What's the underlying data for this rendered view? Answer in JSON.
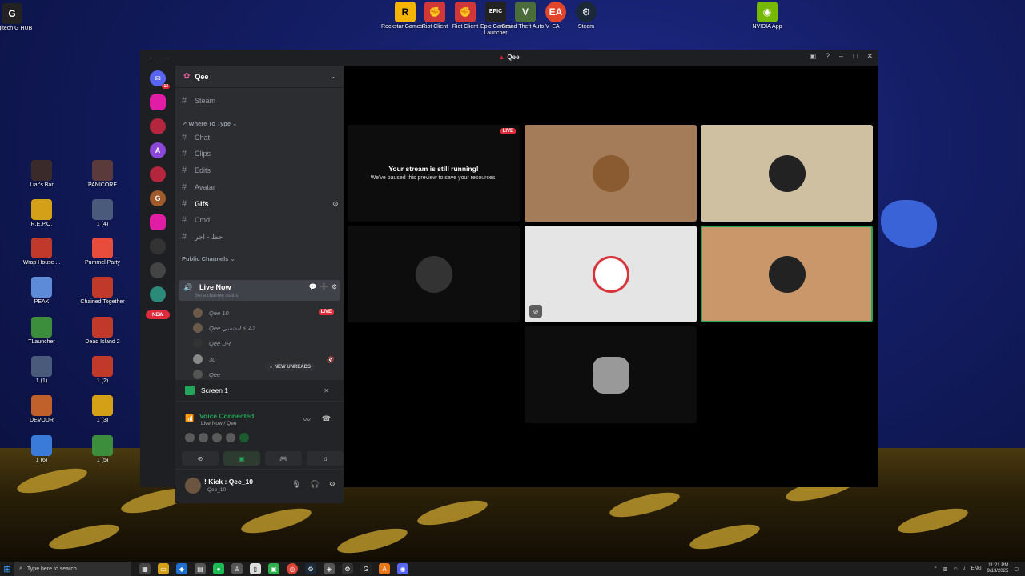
{
  "desktop": {
    "top_icons": [
      {
        "label": "Logitech G HUB",
        "icon": "logitech-icon",
        "color": "#222222"
      },
      {
        "label": "Rockstar Games ...",
        "icon": "rockstar-icon",
        "color": "#f5b400"
      },
      {
        "label": "Riot Client",
        "icon": "riot-icon",
        "color": "#d13639"
      },
      {
        "label": "Riot Client",
        "icon": "riot-icon",
        "color": "#d13639"
      },
      {
        "label": "Epic Games Launcher",
        "icon": "epic-icon",
        "color": "#222222"
      },
      {
        "label": "Grand Theft Auto V",
        "icon": "gta-icon",
        "color": "#4a6b3a"
      },
      {
        "label": "EA",
        "icon": "ea-icon",
        "color": "#e2452a"
      },
      {
        "label": "Steam",
        "icon": "steam-icon",
        "color": "#1b2838"
      },
      {
        "label": "NVIDIA App",
        "icon": "nvidia-icon",
        "color": "#76b900"
      }
    ],
    "left_icons": [
      {
        "label": "Liar's Bar",
        "color": "#3a2a2a"
      },
      {
        "label": "PANICORE",
        "color": "#5a3a3a"
      },
      {
        "label": "R.E.P.O.",
        "color": "#d4a017"
      },
      {
        "label": "1 (4)",
        "color": "#4a5a7a"
      },
      {
        "label": "Wrap House ...",
        "color": "#c0392b"
      },
      {
        "label": "Pummel Party",
        "color": "#e74c3c"
      },
      {
        "label": "PEAK",
        "color": "#5d8bd8"
      },
      {
        "label": "Chained Together",
        "color": "#c0392b"
      },
      {
        "label": "TLauncher",
        "color": "#3c8d3c"
      },
      {
        "label": "Dead Island 2",
        "color": "#c0392b"
      },
      {
        "label": "1 (1)",
        "color": "#4a5a7a"
      },
      {
        "label": "1 (2)",
        "color": "#c0392b"
      },
      {
        "label": "DEVOUR",
        "color": "#c0612b"
      },
      {
        "label": "1 (3)",
        "color": "#d4a017"
      },
      {
        "label": "1 (6)",
        "color": "#3a7ad8"
      },
      {
        "label": "1 (5)",
        "color": "#3c8d3c"
      }
    ]
  },
  "window": {
    "title": "Qee",
    "nav_back": "←",
    "nav_forward": "→"
  },
  "servers": [
    {
      "color": "#5865f2",
      "badge": "13",
      "icon": "discord-home-icon",
      "text": "🎮"
    },
    {
      "color": "#e11da6",
      "badge": "",
      "icon": "server-icon",
      "text": ""
    },
    {
      "color": "#b3263e",
      "badge": "",
      "icon": "server-icon",
      "text": ""
    },
    {
      "color": "#8a47d8",
      "badge": "",
      "icon": "server-icon",
      "text": "A"
    },
    {
      "color": "#b3263e",
      "badge": "",
      "icon": "server-icon",
      "text": ""
    },
    {
      "color": "#a05a2c",
      "badge": "",
      "icon": "server-icon",
      "text": "G"
    },
    {
      "color": "#e11da6",
      "badge": "",
      "icon": "server-icon",
      "text": ""
    },
    {
      "color": "#333333",
      "badge": "",
      "icon": "server-icon",
      "text": ""
    },
    {
      "color": "#444444",
      "badge": "",
      "icon": "server-icon",
      "text": ""
    },
    {
      "color": "#2b8a7a",
      "badge": "",
      "icon": "server-icon",
      "text": ""
    }
  ],
  "new_pill": "NEW",
  "guild": {
    "name": "Qee"
  },
  "channels": {
    "steam": "Steam",
    "category_where": "Where To Type",
    "chat": "Chat",
    "clips": "Clips",
    "edits": "Edits",
    "avatar": "Avatar",
    "gifs": "Gifs",
    "cmd": "Cmd",
    "arabic": "حظ - اجر",
    "category_public": "Public Channels",
    "live_now": "Live Now",
    "live_now_status": "Set a channel status",
    "voice_users": [
      {
        "name": "Qee 10",
        "live": true
      },
      {
        "name": "Qee الدنسي ⚡ A2",
        "live": false
      },
      {
        "name": "Qee DR",
        "live": false
      },
      {
        "name": "30",
        "live": false
      },
      {
        "name": "Qee",
        "live": false
      }
    ],
    "live_label": "LIVE",
    "new_unreads": "NEW UNREADS"
  },
  "screen_card": {
    "title": "Screen 1"
  },
  "voice": {
    "connected": "Voice Connected",
    "channel": "Live Now / Qee"
  },
  "user": {
    "name": "! Kick : Qee_10",
    "status": "Qee_10"
  },
  "stage": {
    "paused_title": "Your stream is still running!",
    "paused_sub": "We've paused this preview to save your resources.",
    "live_label": "LIVE"
  },
  "taskbar": {
    "search_placeholder": "Type here to search",
    "lang": "ENG",
    "time": "11:21 PM",
    "date": "9/13/2025"
  },
  "colors": {
    "discord_bg": "#2b2d31",
    "discord_dark": "#1e1f22",
    "green": "#23a55a",
    "red": "#e02b3a"
  }
}
